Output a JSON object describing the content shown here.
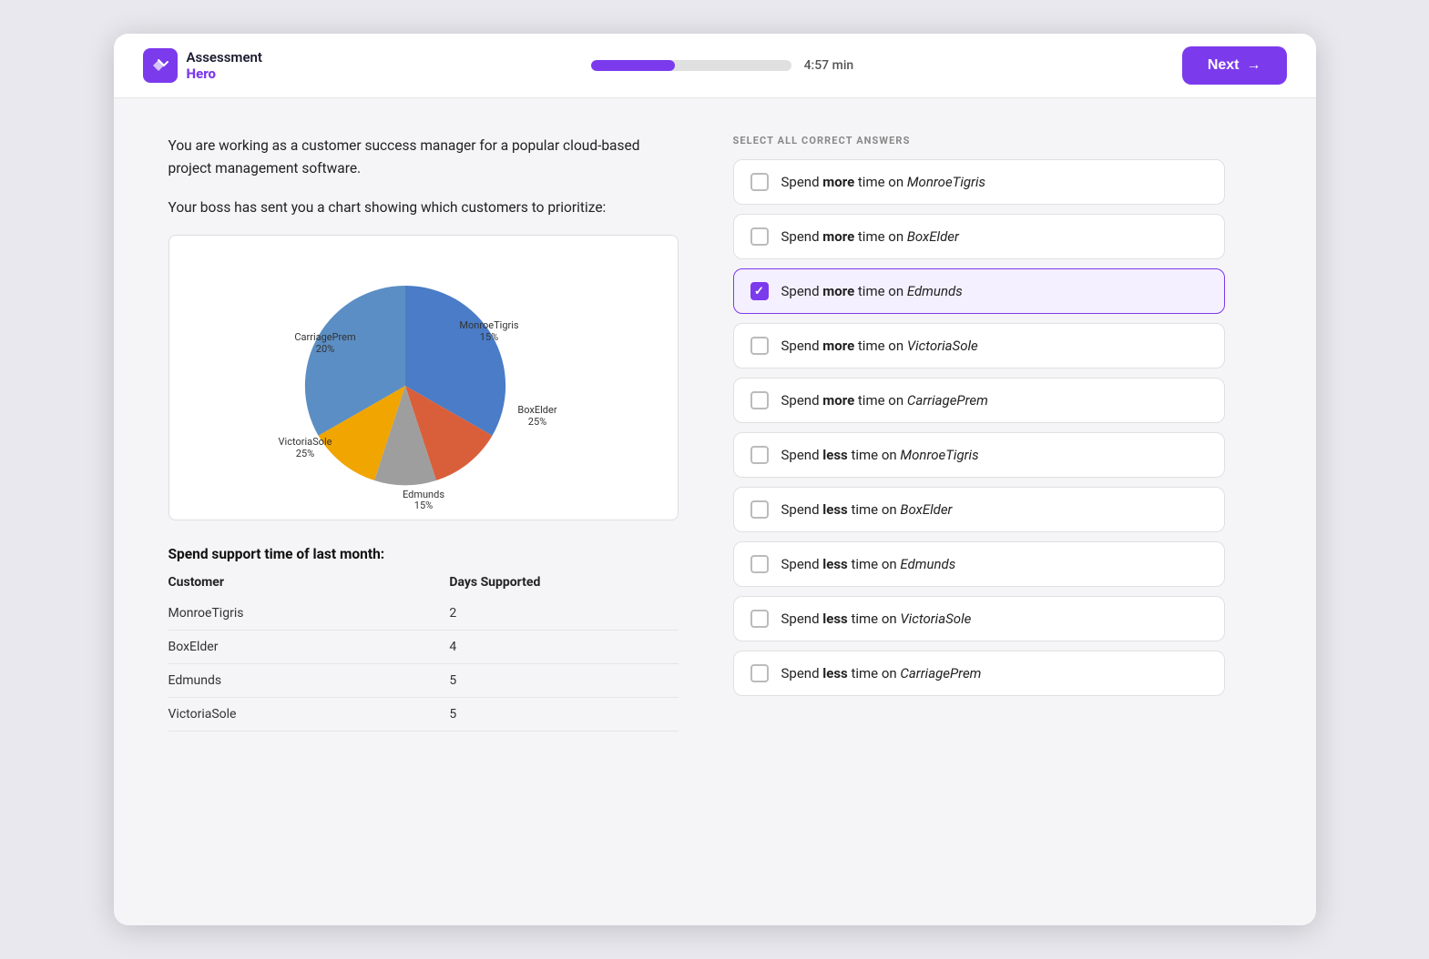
{
  "header": {
    "logo_top": "Assessment",
    "logo_bottom": "Hero",
    "progress_percent": 42,
    "progress_time": "4:57 min",
    "next_label": "Next"
  },
  "question": {
    "line1": "You are working as a customer success manager for a popular cloud-based project management software.",
    "line2": "Your boss has sent you a chart showing which customers to prioritize:",
    "support_heading": "Spend support time of last month:",
    "table_headers": [
      "Customer",
      "Days Supported"
    ],
    "table_rows": [
      {
        "customer": "MonroeTigris",
        "days": "2"
      },
      {
        "customer": "BoxElder",
        "days": "4"
      },
      {
        "customer": "Edmunds",
        "days": "5"
      },
      {
        "customer": "VictoriaSole",
        "days": "5"
      }
    ]
  },
  "chart": {
    "segments": [
      {
        "label": "MonroeTigris",
        "percent": "15%",
        "color": "#4a7cc7"
      },
      {
        "label": "BoxElder",
        "percent": "25%",
        "color": "#d95f3b"
      },
      {
        "label": "Edmunds",
        "percent": "15%",
        "color": "#9e9e9e"
      },
      {
        "label": "VictoriaSole",
        "percent": "25%",
        "color": "#f0a500"
      },
      {
        "label": "CarriagePrem",
        "percent": "20%",
        "color": "#5b8ec4"
      }
    ]
  },
  "answers": {
    "select_label": "SELECT ALL CORRECT ANSWERS",
    "options": [
      {
        "id": "opt1",
        "text_pre": "Spend ",
        "bold": "more",
        "text_mid": " time on ",
        "italic": "MonroeTigris",
        "checked": false
      },
      {
        "id": "opt2",
        "text_pre": "Spend ",
        "bold": "more",
        "text_mid": " time on ",
        "italic": "BoxElder",
        "checked": false
      },
      {
        "id": "opt3",
        "text_pre": "Spend ",
        "bold": "more",
        "text_mid": " time on ",
        "italic": "Edmunds",
        "checked": true
      },
      {
        "id": "opt4",
        "text_pre": "Spend ",
        "bold": "more",
        "text_mid": " time on ",
        "italic": "VictoriaSole",
        "checked": false
      },
      {
        "id": "opt5",
        "text_pre": "Spend ",
        "bold": "more",
        "text_mid": " time on ",
        "italic": "CarriagePrem",
        "checked": false
      },
      {
        "id": "opt6",
        "text_pre": "Spend ",
        "bold": "less",
        "text_mid": " time on ",
        "italic": "MonroeTigris",
        "checked": false
      },
      {
        "id": "opt7",
        "text_pre": "Spend ",
        "bold": "less",
        "text_mid": " time on ",
        "italic": "BoxElder",
        "checked": false
      },
      {
        "id": "opt8",
        "text_pre": "Spend ",
        "bold": "less",
        "text_mid": " time on ",
        "italic": "Edmunds",
        "checked": false
      },
      {
        "id": "opt9",
        "text_pre": "Spend ",
        "bold": "less",
        "text_mid": " time on ",
        "italic": "VictoriaSole",
        "checked": false
      },
      {
        "id": "opt10",
        "text_pre": "Spend ",
        "bold": "less",
        "text_mid": " time on ",
        "italic": "CarriagePrem",
        "checked": false
      }
    ]
  }
}
